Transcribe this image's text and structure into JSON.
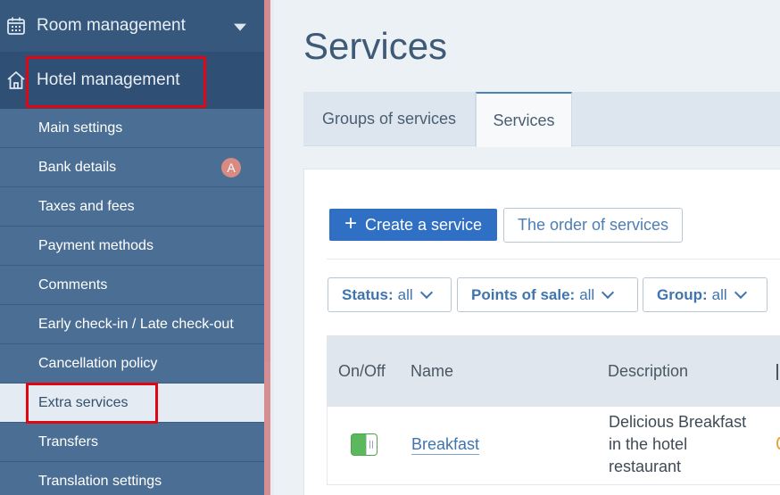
{
  "sidebar": {
    "room_management": "Room management",
    "hotel_management": "Hotel management",
    "items": [
      {
        "label": "Main settings"
      },
      {
        "label": "Bank details",
        "badge": "A"
      },
      {
        "label": "Taxes and fees"
      },
      {
        "label": "Payment methods"
      },
      {
        "label": "Comments"
      },
      {
        "label": "Early check-in / Late check-out"
      },
      {
        "label": "Cancellation policy"
      },
      {
        "label": "Extra services",
        "active": true
      },
      {
        "label": "Transfers"
      },
      {
        "label": "Translation settings"
      }
    ]
  },
  "main": {
    "title": "Services",
    "tabs": [
      {
        "label": "Groups of services"
      },
      {
        "label": "Services",
        "active": true
      }
    ],
    "toolbar": {
      "create_label": "Create a service",
      "order_label": "The order of services"
    },
    "filters": [
      {
        "label": "Status:",
        "value": "all"
      },
      {
        "label": "Points of sale:",
        "value": "all"
      },
      {
        "label": "Group:",
        "value": "all"
      }
    ],
    "table": {
      "columns": [
        "On/Off",
        "Name",
        "Description"
      ],
      "rows": [
        {
          "on": true,
          "name": "Breakfast",
          "description": "Delicious Breakfast in the hotel restaurant"
        }
      ]
    }
  },
  "colors": {
    "sidebar_bg": "#3b5f85",
    "primary_button": "#2f6fc4",
    "highlight_border": "#e10613",
    "toggle_on": "#5cb85c",
    "link": "#3f74ad"
  },
  "icons": [
    "calendar-icon",
    "home-icon",
    "chevron-down-icon",
    "plus-icon"
  ]
}
